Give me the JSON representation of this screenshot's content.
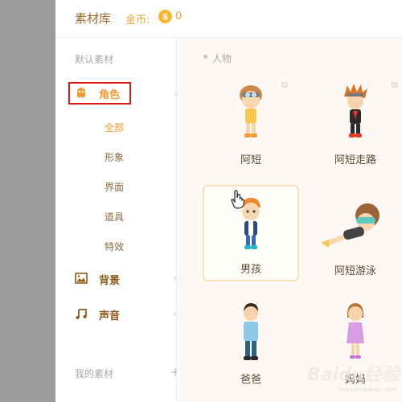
{
  "header": {
    "title": "素材库",
    "coins_label": "金币:",
    "coin_symbol": "$",
    "coins_value": "0"
  },
  "sidebar": {
    "default_section": "默认素材",
    "categories": [
      {
        "label": "角色",
        "expanded": true
      },
      {
        "label": "背景"
      },
      {
        "label": "声音"
      }
    ],
    "role_subitems": [
      "全部",
      "形象",
      "界面",
      "道具",
      "特效"
    ],
    "my_section": "我的素材",
    "my_plus": "+"
  },
  "content": {
    "subheader": "人物",
    "items": [
      "阿短",
      "阿短走路",
      "男孩",
      "阿短游泳",
      "爸爸",
      "妈妈"
    ]
  },
  "watermark": {
    "logo": "Baidu经验",
    "url": "jingyan.baidu.com"
  },
  "colors": {
    "accent": "#f19a2f",
    "brand_text": "#9c6b2c",
    "highlight_box": "#d8161b"
  }
}
